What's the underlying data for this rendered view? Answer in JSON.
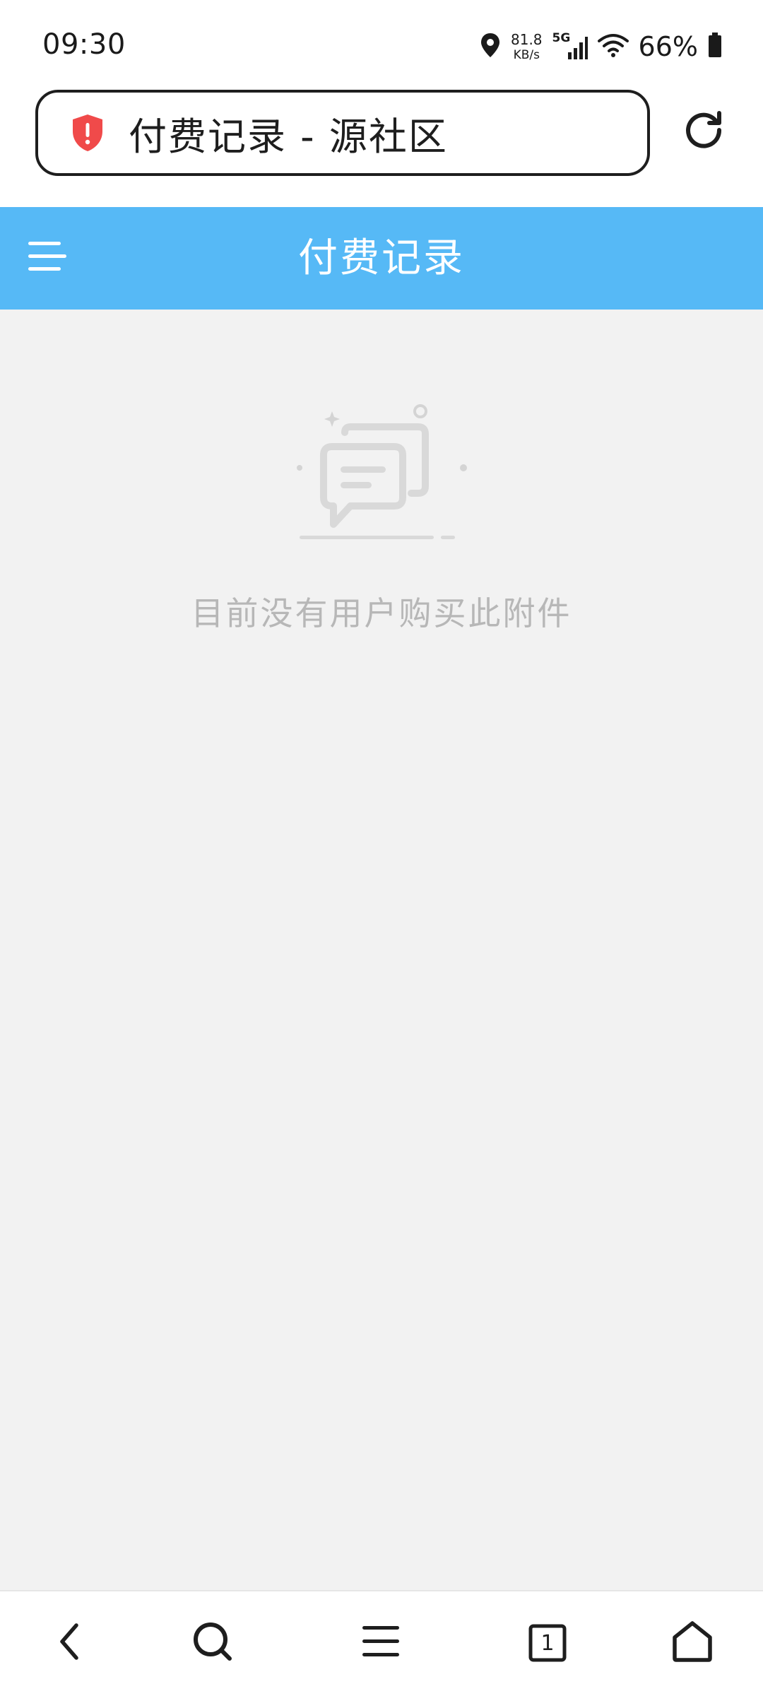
{
  "status_bar": {
    "time": "09:30",
    "net_speed_value": "81.8",
    "net_speed_unit": "KB/s",
    "network_type": "5G",
    "battery": "66%"
  },
  "address_bar": {
    "page_title": "付费记录 - 源社区",
    "security_icon": "shield-alert-icon",
    "reload_icon": "reload-icon"
  },
  "app_header": {
    "title": "付费记录",
    "menu_icon": "menu-icon"
  },
  "empty_state": {
    "message": "目前没有用户购买此附件",
    "icon": "empty-chat-icon"
  },
  "bottom_nav": {
    "tabs_count": "1",
    "items": [
      "back-icon",
      "search-icon",
      "menu-icon",
      "tabs-icon",
      "home-icon"
    ]
  },
  "colors": {
    "header_bg": "#56b9f6",
    "page_bg": "#f2f2f2",
    "shield": "#f04a4a",
    "empty_text": "#b7b7b7"
  }
}
